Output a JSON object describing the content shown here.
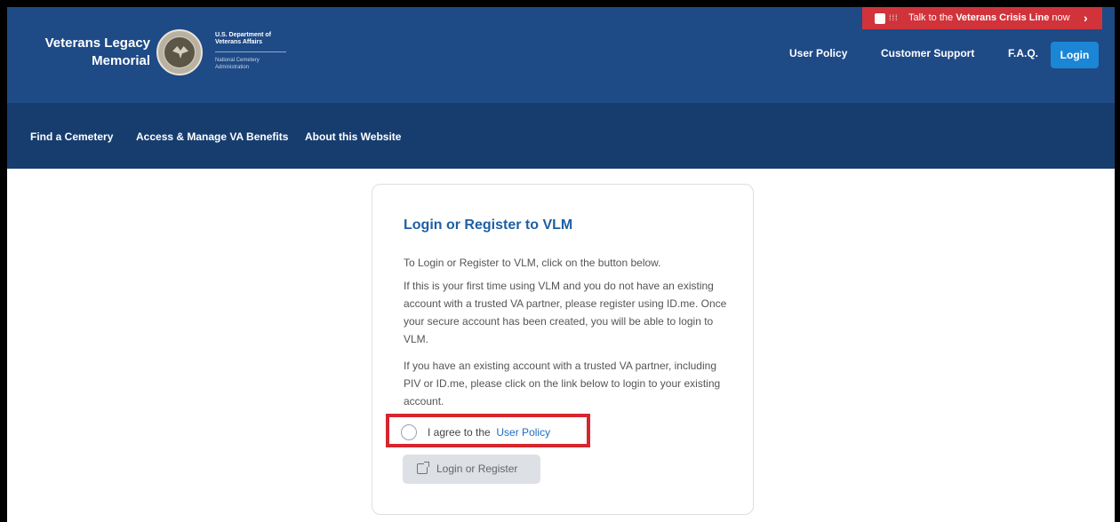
{
  "brand": {
    "title_line1": "Veterans Legacy",
    "title_line2": "Memorial",
    "dept_name": "U.S. Department of Veterans Affairs",
    "dept_sub": "National Cemetery Administration"
  },
  "crisis_banner": {
    "prefix": "Talk to the ",
    "emphasis": "Veterans Crisis Line",
    "suffix": " now",
    "chevron": "›",
    "color": "#d1333b"
  },
  "header_nav": {
    "user_policy": "User Policy",
    "customer_support": "Customer Support",
    "faq": "F.A.Q.",
    "login": "Login"
  },
  "sub_nav": {
    "find_cemetery": "Find a Cemetery",
    "benefits": "Access & Manage VA Benefits",
    "about": "About this Website"
  },
  "login_card": {
    "title": "Login or Register to VLM",
    "para1": "To Login or Register to VLM, click on the button below.",
    "para2": "If this is your first time using VLM and you do not have an existing account with a trusted VA partner, please register using ID.me. Once your secure account has been created, you will be able to login to VLM.",
    "para3": "If you have an existing account with a trusted VA partner, including PIV or ID.me, please click on the link below to login to your existing account.",
    "agree_prefix": "I agree to the",
    "agree_link": "User Policy",
    "agree_checked": false,
    "register_button": "Login or Register"
  },
  "colors": {
    "header": "#1e4a86",
    "subnav": "#173d6f",
    "accent": "#1b86d6",
    "highlight": "#d7262e",
    "title": "#1e5fa3"
  },
  "icons": {
    "seal": "va-seal-icon",
    "crisis": "crisis-line-icon",
    "external": "external-link-icon"
  }
}
